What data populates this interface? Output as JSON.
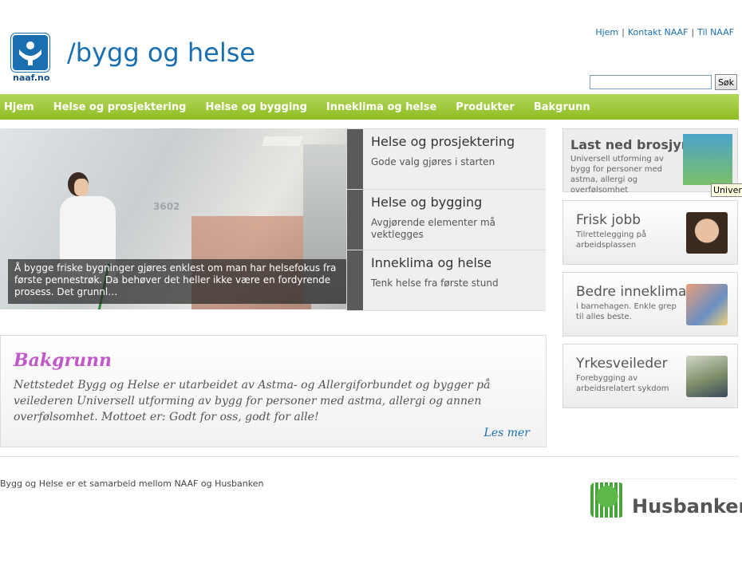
{
  "header": {
    "logo_text": "naaf.no",
    "site_title": "/bygg og helse",
    "toplinks": [
      "Hjem",
      "Kontakt NAAF",
      "Til NAAF"
    ],
    "search_button": "Søk",
    "search_value": ""
  },
  "nav": [
    "Hjem",
    "Helse og prosjektering",
    "Helse og bygging",
    "Inneklima og helse",
    "Produkter",
    "Bakgrunn"
  ],
  "hero": {
    "room_number": "3602",
    "caption": "Å bygge friske bygninger gjøres enklest om man har helsefokus fra første pennestrøk. Da behøver det heller ikke være en fordyrende prosess. Det grunnl…",
    "tabs": [
      {
        "title": "Helse og prosjektering",
        "desc": "Gode valg gjøres i starten"
      },
      {
        "title": "Helse og bygging",
        "desc": "Avgjørende elementer må vektlegges"
      },
      {
        "title": "Inneklima og helse",
        "desc": "Tenk helse fra første stund"
      }
    ]
  },
  "side": [
    {
      "title": "Last ned brosjyre",
      "desc": "Universell utforming av bygg for personer med astma, allergi og overfølsomhet"
    },
    {
      "title": "Frisk jobb",
      "desc": "Tilrettelegging på arbeidsplassen"
    },
    {
      "title": "Bedre inneklima",
      "desc": "i barnehagen. Enkle grep til alles beste."
    },
    {
      "title": "Yrkesveileder",
      "desc": "Forebygging av arbeidsrelatert sykdom"
    }
  ],
  "tooltip": "Univers",
  "bakgrunn": {
    "title": "Bakgrunn",
    "text": "Nettstedet Bygg og Helse er utarbeidet av Astma- og Allergiforbundet og bygger på veilederen Universell utforming av bygg for personer med astma, allergi og annen overfølsomhet. Mottoet er: Godt for oss, godt for alle!",
    "more": "Les mer"
  },
  "footer": {
    "text": "Bygg og Helse er et samarbeid mellom NAAF og Husbanken",
    "partner": "Husbanken"
  },
  "colors": {
    "brand_blue": "#1a6fb0",
    "nav_green": "#99c430",
    "bakgrunn_purple": "#c257c9"
  }
}
